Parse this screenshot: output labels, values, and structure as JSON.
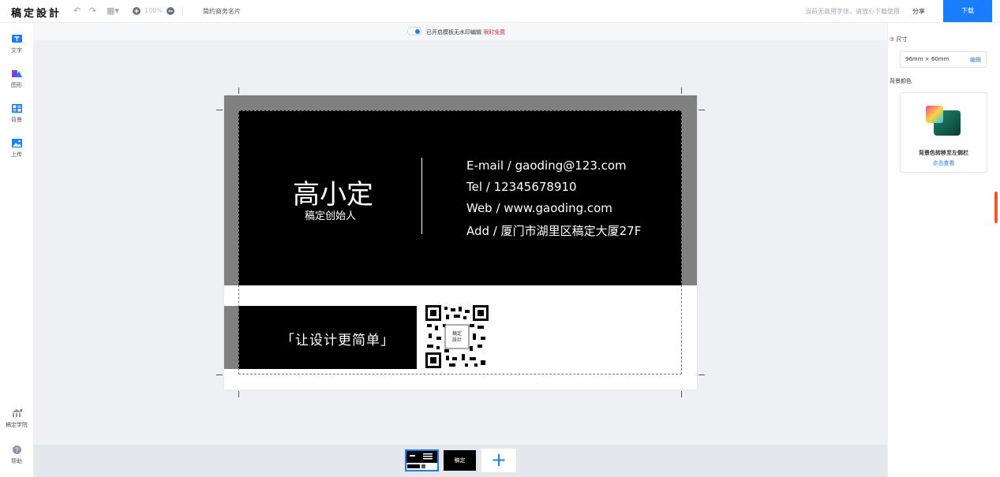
{
  "app": {
    "logo": "稿定設計"
  },
  "toolbar": {
    "zoom": "100%",
    "doc_title": "简约商务名片",
    "font_tip": "当前无商用字体，请放心下载使用",
    "share_label": "分享",
    "download_label": "下载"
  },
  "sidebar": {
    "items": [
      {
        "label": "文字",
        "icon": "text-icon"
      },
      {
        "label": "图形",
        "icon": "shape-icon"
      },
      {
        "label": "背景",
        "icon": "background-icon"
      },
      {
        "label": "上传",
        "icon": "upload-icon"
      }
    ],
    "academy_label": "稿定学院",
    "help_label": "帮助"
  },
  "watermark": {
    "text": "已开启模板无水印编辑",
    "free_text": "限时免费",
    "enabled": true
  },
  "card": {
    "name": "高小定",
    "role": "稿定创始人",
    "email": "E-mail / gaoding@123.com",
    "tel": "Tel / 12345678910",
    "web": "Web / www.gaoding.com",
    "address": "Add / 厦门市湖里区稿定大厦27F",
    "slogan": "「让设计更简单」",
    "qr_center": "稿定\n設計"
  },
  "panel": {
    "size_label": "尺寸",
    "size_value": "96mm × 60mm",
    "edit_label": "编辑",
    "bg_color_label": "背景颜色",
    "bg_tip": "背景色转移至左侧栏",
    "bg_view": "点击查看"
  },
  "pages": {
    "thumb2_label": "稿定",
    "add_label": "+"
  },
  "colors": {
    "accent": "#1a7cff",
    "promo_red": "#f5222d",
    "card_black": "#000000",
    "card_gray": "#808080"
  }
}
